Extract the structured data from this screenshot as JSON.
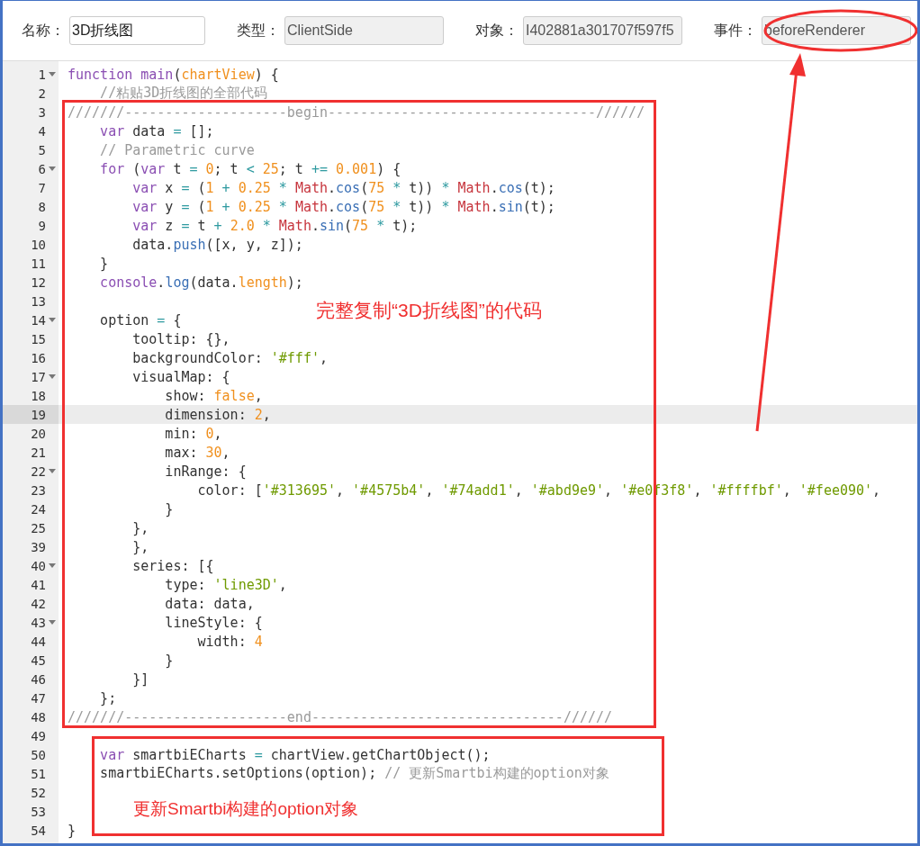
{
  "header": {
    "fields": [
      {
        "label": "名称：",
        "value": "3D折线图",
        "disabled": false
      },
      {
        "label": "类型：",
        "value": "ClientSide",
        "disabled": true
      },
      {
        "label": "对象：",
        "value": "I402881a301707f597f5",
        "disabled": true
      },
      {
        "label": "事件：",
        "value": "beforeRenderer",
        "disabled": true
      }
    ]
  },
  "editor": {
    "lines": [
      {
        "number": "1",
        "foldable": true,
        "active": false,
        "tokens": [
          {
            "kind": "kw",
            "text": "function main"
          },
          {
            "kind": "plain",
            "text": "("
          },
          {
            "kind": "num",
            "text": "chartView"
          },
          {
            "kind": "plain",
            "text": ") {"
          }
        ]
      },
      {
        "number": "2",
        "foldable": false,
        "active": false,
        "tokens": [
          {
            "kind": "comment",
            "text": "    //粘贴3D折线图的全部代码"
          }
        ]
      },
      {
        "number": "3",
        "foldable": false,
        "active": false,
        "tokens": [
          {
            "kind": "comment",
            "text": "///////--------------------begin---------------------------------//////"
          }
        ]
      },
      {
        "number": "4",
        "foldable": false,
        "active": false,
        "tokens": [
          {
            "kind": "kw",
            "text": "    var"
          },
          {
            "kind": "plain",
            "text": " data "
          },
          {
            "kind": "op",
            "text": "="
          },
          {
            "kind": "plain",
            "text": " [];"
          }
        ]
      },
      {
        "number": "5",
        "foldable": false,
        "active": false,
        "tokens": [
          {
            "kind": "comment",
            "text": "    // Parametric curve"
          }
        ]
      },
      {
        "number": "6",
        "foldable": true,
        "active": false,
        "tokens": [
          {
            "kind": "kw",
            "text": "    for"
          },
          {
            "kind": "plain",
            "text": " ("
          },
          {
            "kind": "kw",
            "text": "var"
          },
          {
            "kind": "plain",
            "text": " t "
          },
          {
            "kind": "op",
            "text": "="
          },
          {
            "kind": "num",
            "text": " 0"
          },
          {
            "kind": "plain",
            "text": "; t "
          },
          {
            "kind": "op",
            "text": "<"
          },
          {
            "kind": "num",
            "text": " 25"
          },
          {
            "kind": "plain",
            "text": "; t "
          },
          {
            "kind": "op",
            "text": "+="
          },
          {
            "kind": "num",
            "text": " 0.001"
          },
          {
            "kind": "plain",
            "text": ") {"
          }
        ]
      },
      {
        "number": "7",
        "foldable": false,
        "active": false,
        "tokens": [
          {
            "kind": "kw",
            "text": "        var"
          },
          {
            "kind": "plain",
            "text": " x "
          },
          {
            "kind": "op",
            "text": "="
          },
          {
            "kind": "plain",
            "text": " ("
          },
          {
            "kind": "num",
            "text": "1"
          },
          {
            "kind": "op",
            "text": " + "
          },
          {
            "kind": "num",
            "text": "0.25"
          },
          {
            "kind": "op",
            "text": " * "
          },
          {
            "kind": "obj",
            "text": "Math"
          },
          {
            "kind": "plain",
            "text": "."
          },
          {
            "kind": "fn",
            "text": "cos"
          },
          {
            "kind": "plain",
            "text": "("
          },
          {
            "kind": "num",
            "text": "75"
          },
          {
            "kind": "op",
            "text": " * "
          },
          {
            "kind": "plain",
            "text": "t)) "
          },
          {
            "kind": "op",
            "text": "* "
          },
          {
            "kind": "obj",
            "text": "Math"
          },
          {
            "kind": "plain",
            "text": "."
          },
          {
            "kind": "fn",
            "text": "cos"
          },
          {
            "kind": "plain",
            "text": "(t);"
          }
        ]
      },
      {
        "number": "8",
        "foldable": false,
        "active": false,
        "tokens": [
          {
            "kind": "kw",
            "text": "        var"
          },
          {
            "kind": "plain",
            "text": " y "
          },
          {
            "kind": "op",
            "text": "="
          },
          {
            "kind": "plain",
            "text": " ("
          },
          {
            "kind": "num",
            "text": "1"
          },
          {
            "kind": "op",
            "text": " + "
          },
          {
            "kind": "num",
            "text": "0.25"
          },
          {
            "kind": "op",
            "text": " * "
          },
          {
            "kind": "obj",
            "text": "Math"
          },
          {
            "kind": "plain",
            "text": "."
          },
          {
            "kind": "fn",
            "text": "cos"
          },
          {
            "kind": "plain",
            "text": "("
          },
          {
            "kind": "num",
            "text": "75"
          },
          {
            "kind": "op",
            "text": " * "
          },
          {
            "kind": "plain",
            "text": "t)) "
          },
          {
            "kind": "op",
            "text": "* "
          },
          {
            "kind": "obj",
            "text": "Math"
          },
          {
            "kind": "plain",
            "text": "."
          },
          {
            "kind": "fn",
            "text": "sin"
          },
          {
            "kind": "plain",
            "text": "(t);"
          }
        ]
      },
      {
        "number": "9",
        "foldable": false,
        "active": false,
        "tokens": [
          {
            "kind": "kw",
            "text": "        var"
          },
          {
            "kind": "plain",
            "text": " z "
          },
          {
            "kind": "op",
            "text": "="
          },
          {
            "kind": "plain",
            "text": " t "
          },
          {
            "kind": "op",
            "text": "+ "
          },
          {
            "kind": "num",
            "text": "2.0"
          },
          {
            "kind": "op",
            "text": " * "
          },
          {
            "kind": "obj",
            "text": "Math"
          },
          {
            "kind": "plain",
            "text": "."
          },
          {
            "kind": "fn",
            "text": "sin"
          },
          {
            "kind": "plain",
            "text": "("
          },
          {
            "kind": "num",
            "text": "75"
          },
          {
            "kind": "op",
            "text": " * "
          },
          {
            "kind": "plain",
            "text": "t);"
          }
        ]
      },
      {
        "number": "10",
        "foldable": false,
        "active": false,
        "tokens": [
          {
            "kind": "plain",
            "text": "        data."
          },
          {
            "kind": "fn",
            "text": "push"
          },
          {
            "kind": "plain",
            "text": "([x, y, z]);"
          }
        ]
      },
      {
        "number": "11",
        "foldable": false,
        "active": false,
        "tokens": [
          {
            "kind": "plain",
            "text": "    }"
          }
        ]
      },
      {
        "number": "12",
        "foldable": false,
        "active": false,
        "tokens": [
          {
            "kind": "kw",
            "text": "    console"
          },
          {
            "kind": "plain",
            "text": "."
          },
          {
            "kind": "fn",
            "text": "log"
          },
          {
            "kind": "plain",
            "text": "(data."
          },
          {
            "kind": "num",
            "text": "length"
          },
          {
            "kind": "plain",
            "text": ");"
          }
        ]
      },
      {
        "number": "13",
        "foldable": false,
        "active": false
      },
      {
        "number": "14",
        "foldable": true,
        "active": false,
        "tokens": [
          {
            "kind": "plain",
            "text": "    option "
          },
          {
            "kind": "op",
            "text": "="
          },
          {
            "kind": "plain",
            "text": " {"
          }
        ]
      },
      {
        "number": "15",
        "foldable": false,
        "active": false,
        "tokens": [
          {
            "kind": "plain",
            "text": "        tooltip: {},"
          }
        ]
      },
      {
        "number": "16",
        "foldable": false,
        "active": false,
        "tokens": [
          {
            "kind": "plain",
            "text": "        backgroundColor: "
          },
          {
            "kind": "str",
            "text": "'#fff'"
          },
          {
            "kind": "plain",
            "text": ","
          }
        ]
      },
      {
        "number": "17",
        "foldable": true,
        "active": false,
        "tokens": [
          {
            "kind": "plain",
            "text": "        visualMap: {"
          }
        ]
      },
      {
        "number": "18",
        "foldable": false,
        "active": false,
        "tokens": [
          {
            "kind": "plain",
            "text": "            show: "
          },
          {
            "kind": "num",
            "text": "false"
          },
          {
            "kind": "plain",
            "text": ","
          }
        ]
      },
      {
        "number": "19",
        "foldable": false,
        "active": true,
        "tokens": [
          {
            "kind": "plain",
            "text": "            dimension: "
          },
          {
            "kind": "num",
            "text": "2"
          },
          {
            "kind": "plain",
            "text": ","
          }
        ]
      },
      {
        "number": "20",
        "foldable": false,
        "active": false,
        "tokens": [
          {
            "kind": "plain",
            "text": "            min: "
          },
          {
            "kind": "num",
            "text": "0"
          },
          {
            "kind": "plain",
            "text": ","
          }
        ]
      },
      {
        "number": "21",
        "foldable": false,
        "active": false,
        "tokens": [
          {
            "kind": "plain",
            "text": "            max: "
          },
          {
            "kind": "num",
            "text": "30"
          },
          {
            "kind": "plain",
            "text": ","
          }
        ]
      },
      {
        "number": "22",
        "foldable": true,
        "active": false,
        "tokens": [
          {
            "kind": "plain",
            "text": "            inRange: {"
          }
        ]
      },
      {
        "number": "23",
        "foldable": false,
        "active": false,
        "tokens": [
          {
            "kind": "plain",
            "text": "                color: ["
          },
          {
            "kind": "str",
            "text": "'#313695'"
          },
          {
            "kind": "plain",
            "text": ", "
          },
          {
            "kind": "str",
            "text": "'#4575b4'"
          },
          {
            "kind": "plain",
            "text": ", "
          },
          {
            "kind": "str",
            "text": "'#74add1'"
          },
          {
            "kind": "plain",
            "text": ", "
          },
          {
            "kind": "str",
            "text": "'#abd9e9'"
          },
          {
            "kind": "plain",
            "text": ", "
          },
          {
            "kind": "str",
            "text": "'#e0f3f8'"
          },
          {
            "kind": "plain",
            "text": ", "
          },
          {
            "kind": "str",
            "text": "'#ffffbf'"
          },
          {
            "kind": "plain",
            "text": ", "
          },
          {
            "kind": "str",
            "text": "'#fee090'"
          },
          {
            "kind": "plain",
            "text": ","
          }
        ]
      },
      {
        "number": "24",
        "foldable": false,
        "active": false,
        "tokens": [
          {
            "kind": "plain",
            "text": "            }"
          }
        ]
      },
      {
        "number": "25",
        "foldable": false,
        "active": false,
        "tokens": [
          {
            "kind": "plain",
            "text": "        },"
          }
        ]
      },
      {
        "number": "39",
        "foldable": false,
        "active": false,
        "tokens": [
          {
            "kind": "plain",
            "text": "        },"
          }
        ]
      },
      {
        "number": "40",
        "foldable": true,
        "active": false,
        "tokens": [
          {
            "kind": "plain",
            "text": "        series: [{"
          }
        ]
      },
      {
        "number": "41",
        "foldable": false,
        "active": false,
        "tokens": [
          {
            "kind": "plain",
            "text": "            type: "
          },
          {
            "kind": "str",
            "text": "'line3D'"
          },
          {
            "kind": "plain",
            "text": ","
          }
        ]
      },
      {
        "number": "42",
        "foldable": false,
        "active": false,
        "tokens": [
          {
            "kind": "plain",
            "text": "            data: data,"
          }
        ]
      },
      {
        "number": "43",
        "foldable": true,
        "active": false,
        "tokens": [
          {
            "kind": "plain",
            "text": "            lineStyle: {"
          }
        ]
      },
      {
        "number": "44",
        "foldable": false,
        "active": false,
        "tokens": [
          {
            "kind": "plain",
            "text": "                width: "
          },
          {
            "kind": "num",
            "text": "4"
          }
        ]
      },
      {
        "number": "45",
        "foldable": false,
        "active": false,
        "tokens": [
          {
            "kind": "plain",
            "text": "            }"
          }
        ]
      },
      {
        "number": "46",
        "foldable": false,
        "active": false,
        "tokens": [
          {
            "kind": "plain",
            "text": "        }]"
          }
        ]
      },
      {
        "number": "47",
        "foldable": false,
        "active": false,
        "tokens": [
          {
            "kind": "plain",
            "text": "    };"
          }
        ]
      },
      {
        "number": "48",
        "foldable": false,
        "active": false,
        "tokens": [
          {
            "kind": "comment",
            "text": "///////--------------------end-------------------------------//////"
          }
        ]
      },
      {
        "number": "49",
        "foldable": false,
        "active": false
      },
      {
        "number": "50",
        "foldable": false,
        "active": false,
        "tokens": [
          {
            "kind": "kw",
            "text": "    var"
          },
          {
            "kind": "plain",
            "text": " smartbiECharts "
          },
          {
            "kind": "op",
            "text": "="
          },
          {
            "kind": "plain",
            "text": " chartView.getChartObject();"
          }
        ]
      },
      {
        "number": "51",
        "foldable": false,
        "active": false,
        "tokens": [
          {
            "kind": "plain",
            "text": "    smartbiECharts.setOptions(option); "
          },
          {
            "kind": "comment",
            "text": "// 更新Smartbi构建的option对象"
          }
        ]
      },
      {
        "number": "52",
        "foldable": false,
        "active": false
      },
      {
        "number": "53",
        "foldable": false,
        "active": false
      },
      {
        "number": "54",
        "foldable": false,
        "active": false,
        "tokens": [
          {
            "kind": "plain",
            "text": "}"
          }
        ]
      }
    ]
  },
  "annotations": [
    "完整复制“3D折线图”的代码",
    "更新Smartbi构建的option对象"
  ]
}
